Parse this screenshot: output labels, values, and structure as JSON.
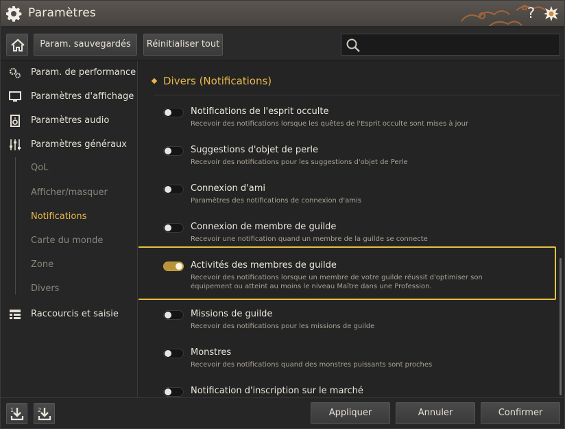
{
  "window": {
    "title": "Paramètres",
    "help": "?"
  },
  "toolbar": {
    "saved_label": "Param. sauvegardés",
    "reset_label": "Réinitialiser tout",
    "search_value": ""
  },
  "sidebar": {
    "items": [
      {
        "label": "Param. de performance",
        "icon": "gears-icon"
      },
      {
        "label": "Paramètres d'affichage",
        "icon": "monitor-icon"
      },
      {
        "label": "Paramètres audio",
        "icon": "speaker-icon"
      },
      {
        "label": "Paramètres généraux",
        "icon": "sliders-icon"
      },
      {
        "label": "Raccourcis et saisie",
        "icon": "keyboard-list-icon"
      }
    ],
    "subitems": [
      {
        "label": "QoL"
      },
      {
        "label": "Afficher/masquer"
      },
      {
        "label": "Notifications"
      },
      {
        "label": "Carte du monde"
      },
      {
        "label": "Zone"
      },
      {
        "label": "Divers"
      }
    ],
    "active_subitem": "Notifications"
  },
  "main": {
    "section_title": "Divers (Notifications)",
    "rows": [
      {
        "title": "Notifications de l'esprit occulte",
        "desc": "Recevoir des notifications lorsque les quêtes de l'Esprit occulte sont mises à jour",
        "on": false
      },
      {
        "title": "Suggestions d'objet de perle",
        "desc": "Recevoir des notifications pour les suggestions d'objet de Perle",
        "on": false
      },
      {
        "title": "Connexion d'ami",
        "desc": "Paramètres des notifications de connexion d'amis",
        "on": false
      },
      {
        "title": "Connexion de membre de guilde",
        "desc": "Recevoir une notification quand un membre de la guilde se connecte",
        "on": false
      },
      {
        "title": "Activités des membres de guilde",
        "desc": "Recevoir des notifications lorsque un membre de votre guilde réussit d'optimiser son équipement ou atteint au moins le niveau Maître dans une Profession.",
        "on": true
      },
      {
        "title": "Missions de guilde",
        "desc": "Recevoir des notifications pour les missions de guilde",
        "on": false
      },
      {
        "title": "Monstres",
        "desc": "Recevoir des notifications quand des monstres puissants sont proches",
        "on": false
      },
      {
        "title": "Notification d'inscription sur le marché",
        "desc": "",
        "on": false
      }
    ]
  },
  "footer": {
    "slot1": "1",
    "slot2": "2",
    "apply_label": "Appliquer",
    "cancel_label": "Annuler",
    "confirm_label": "Confirmer"
  },
  "colors": {
    "accent": "#e8b84a",
    "highlight": "#e8c041",
    "toggle_on": "#b8933a"
  }
}
